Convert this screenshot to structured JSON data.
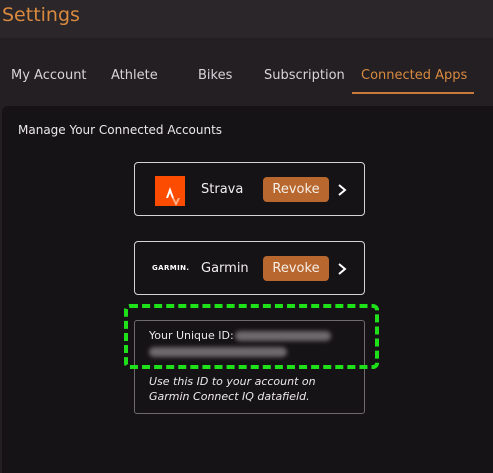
{
  "header": {
    "title": "Settings"
  },
  "tabs": [
    {
      "label": "My Account"
    },
    {
      "label": "Athlete"
    },
    {
      "label": "Bikes"
    },
    {
      "label": "Subscription"
    },
    {
      "label": "Connected Apps",
      "active": true
    }
  ],
  "panel": {
    "title": "Manage Your Connected Accounts",
    "apps": [
      {
        "name": "Strava",
        "logo": "strava-logo-icon",
        "action": "Revoke"
      },
      {
        "name": "Garmin",
        "logo_text": "GARMIN.",
        "action": "Revoke"
      }
    ],
    "unique_id": {
      "label": "Your Unique ID:",
      "hint": "Use this ID to your account on Garmin Connect IQ datafield."
    }
  },
  "colors": {
    "accent": "#d98a3f",
    "revoke": "#b8682f",
    "strava": "#fc4c02",
    "highlight": "#1fe11a"
  }
}
